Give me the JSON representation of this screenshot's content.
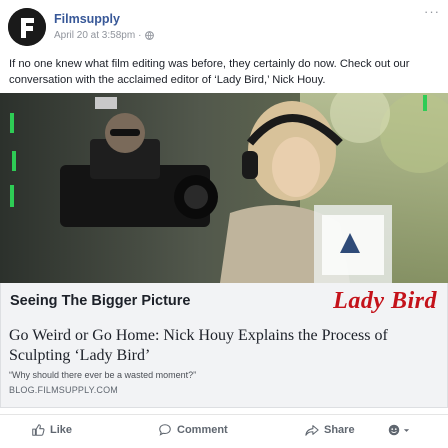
{
  "post": {
    "page_name": "Filmsupply",
    "timestamp": "April 20 at 3:58pm",
    "separator": "·",
    "more_label": "···",
    "text": "If no one knew what film editing was before, they certainly do now. Check out our conversation with the acclaimed editor of ‘Lady Bird,’ Nick Houy."
  },
  "link_preview": {
    "banner_title": "Seeing The Bigger Picture",
    "brand_text": "Lady Bird",
    "headline": "Go Weird or Go Home: Nick Houy Explains the Process of Sculpting ‘Lady Bird’",
    "description": "“Why should there ever be a wasted moment?”",
    "domain": "BLOG.FILMSUPPLY.COM"
  },
  "actions": {
    "like": "Like",
    "comment": "Comment",
    "share": "Share"
  },
  "icons": {
    "avatar": "filmsupply-logo",
    "globe": "globe-icon",
    "like": "thumbs-up-icon",
    "comment": "comment-bubble-icon",
    "share": "share-arrow-icon",
    "react": "reaction-picker-icon"
  },
  "colors": {
    "link_blue": "#385898",
    "brand_red": "#c4121a",
    "meta_gray": "#90949c"
  }
}
